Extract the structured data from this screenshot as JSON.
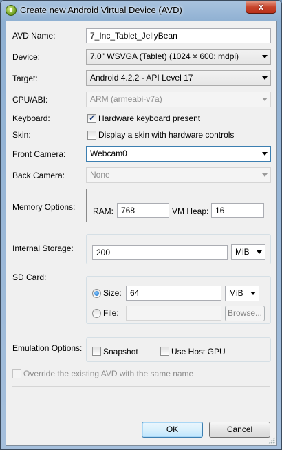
{
  "window": {
    "title": "Create new Android Virtual Device (AVD)",
    "close_glyph": "x"
  },
  "form": {
    "avd_name": {
      "label": "AVD Name:",
      "value": "7_Inc_Tablet_JellyBean"
    },
    "device": {
      "label": "Device:",
      "value": "7.0\" WSVGA (Tablet) (1024 × 600: mdpi)"
    },
    "target": {
      "label": "Target:",
      "value": "Android 4.2.2 - API Level 17"
    },
    "cpu_abi": {
      "label": "CPU/ABI:",
      "value": "ARM (armeabi-v7a)"
    },
    "keyboard": {
      "label": "Keyboard:",
      "option": "Hardware keyboard present",
      "checked": true
    },
    "skin": {
      "label": "Skin:",
      "option": "Display a skin with hardware controls",
      "checked": false
    },
    "front_camera": {
      "label": "Front Camera:",
      "value": "Webcam0"
    },
    "back_camera": {
      "label": "Back Camera:",
      "value": "None"
    },
    "memory": {
      "label": "Memory Options:",
      "ram_label": "RAM:",
      "ram": "768",
      "heap_label": "VM Heap:",
      "heap": "16"
    },
    "internal_storage": {
      "label": "Internal Storage:",
      "value": "200",
      "unit": "MiB"
    },
    "sd_card": {
      "label": "SD Card:",
      "size_label": "Size:",
      "size": "64",
      "unit": "MiB",
      "file_label": "File:",
      "file": "",
      "browse": "Browse...",
      "selected": "size"
    },
    "emulation": {
      "label": "Emulation Options:",
      "snapshot": "Snapshot",
      "host_gpu": "Use Host GPU"
    },
    "override": {
      "label": "Override the existing AVD with the same name"
    }
  },
  "buttons": {
    "ok": "OK",
    "cancel": "Cancel"
  },
  "colors": {
    "focus_border": "#3c7fb1",
    "disabled_text": "#8d8d8d"
  }
}
